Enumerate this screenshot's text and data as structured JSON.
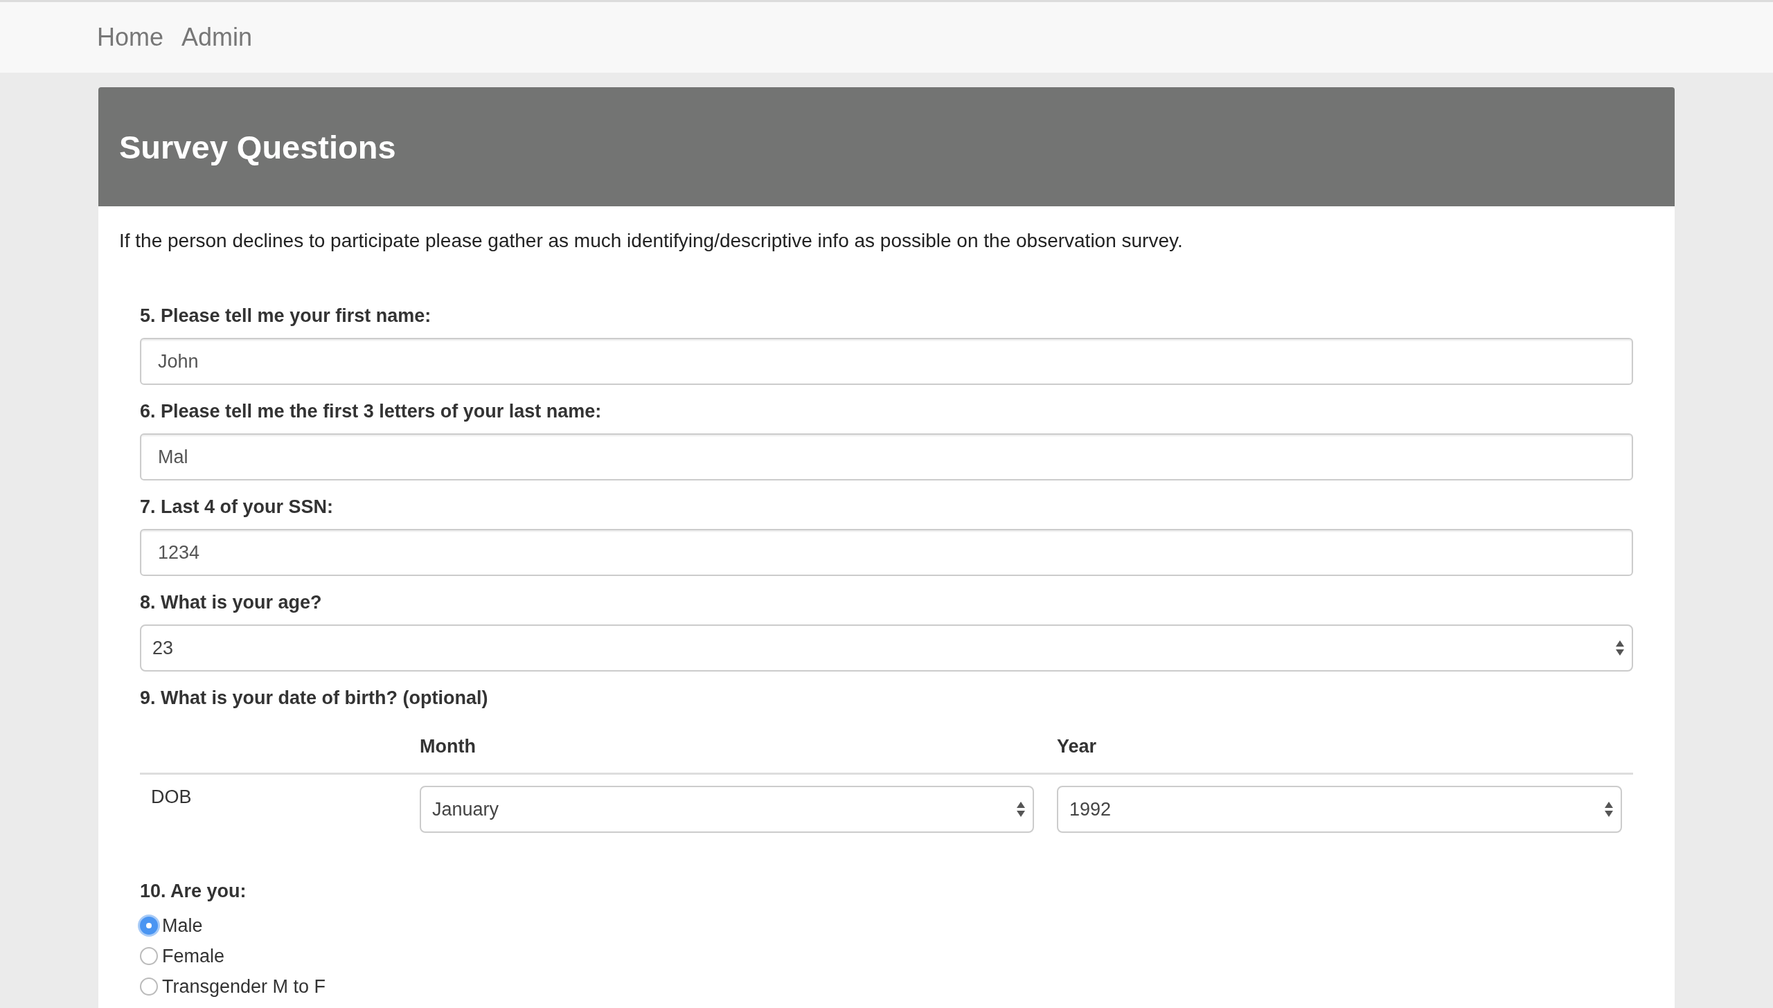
{
  "nav": [
    {
      "label": "Home"
    },
    {
      "label": "Admin"
    }
  ],
  "panel": {
    "title": "Survey Questions",
    "intro": "If the person declines to participate please gather as much identifying/descriptive info as possible on the observation survey."
  },
  "questions": [
    {
      "kind": "text",
      "label": "5. Please tell me your first name:",
      "value": "John"
    },
    {
      "kind": "text",
      "label": "6. Please tell me the first 3 letters of your last name:",
      "value": "Mal"
    },
    {
      "kind": "text",
      "label": "7. Last 4 of your SSN:",
      "value": "1234"
    },
    {
      "kind": "select",
      "label": "8. What is your age?",
      "value": "23"
    },
    {
      "kind": "dob",
      "label": "9. What is your date of birth? (optional)",
      "columns": [
        "Month",
        "Year"
      ],
      "row_label": "DOB",
      "month": "January",
      "year": "1992"
    },
    {
      "kind": "radio",
      "label": "10. Are you:",
      "options": [
        {
          "label": "Male",
          "selected": true
        },
        {
          "label": "Female",
          "selected": false
        },
        {
          "label": "Transgender M to F",
          "selected": false
        }
      ]
    }
  ]
}
